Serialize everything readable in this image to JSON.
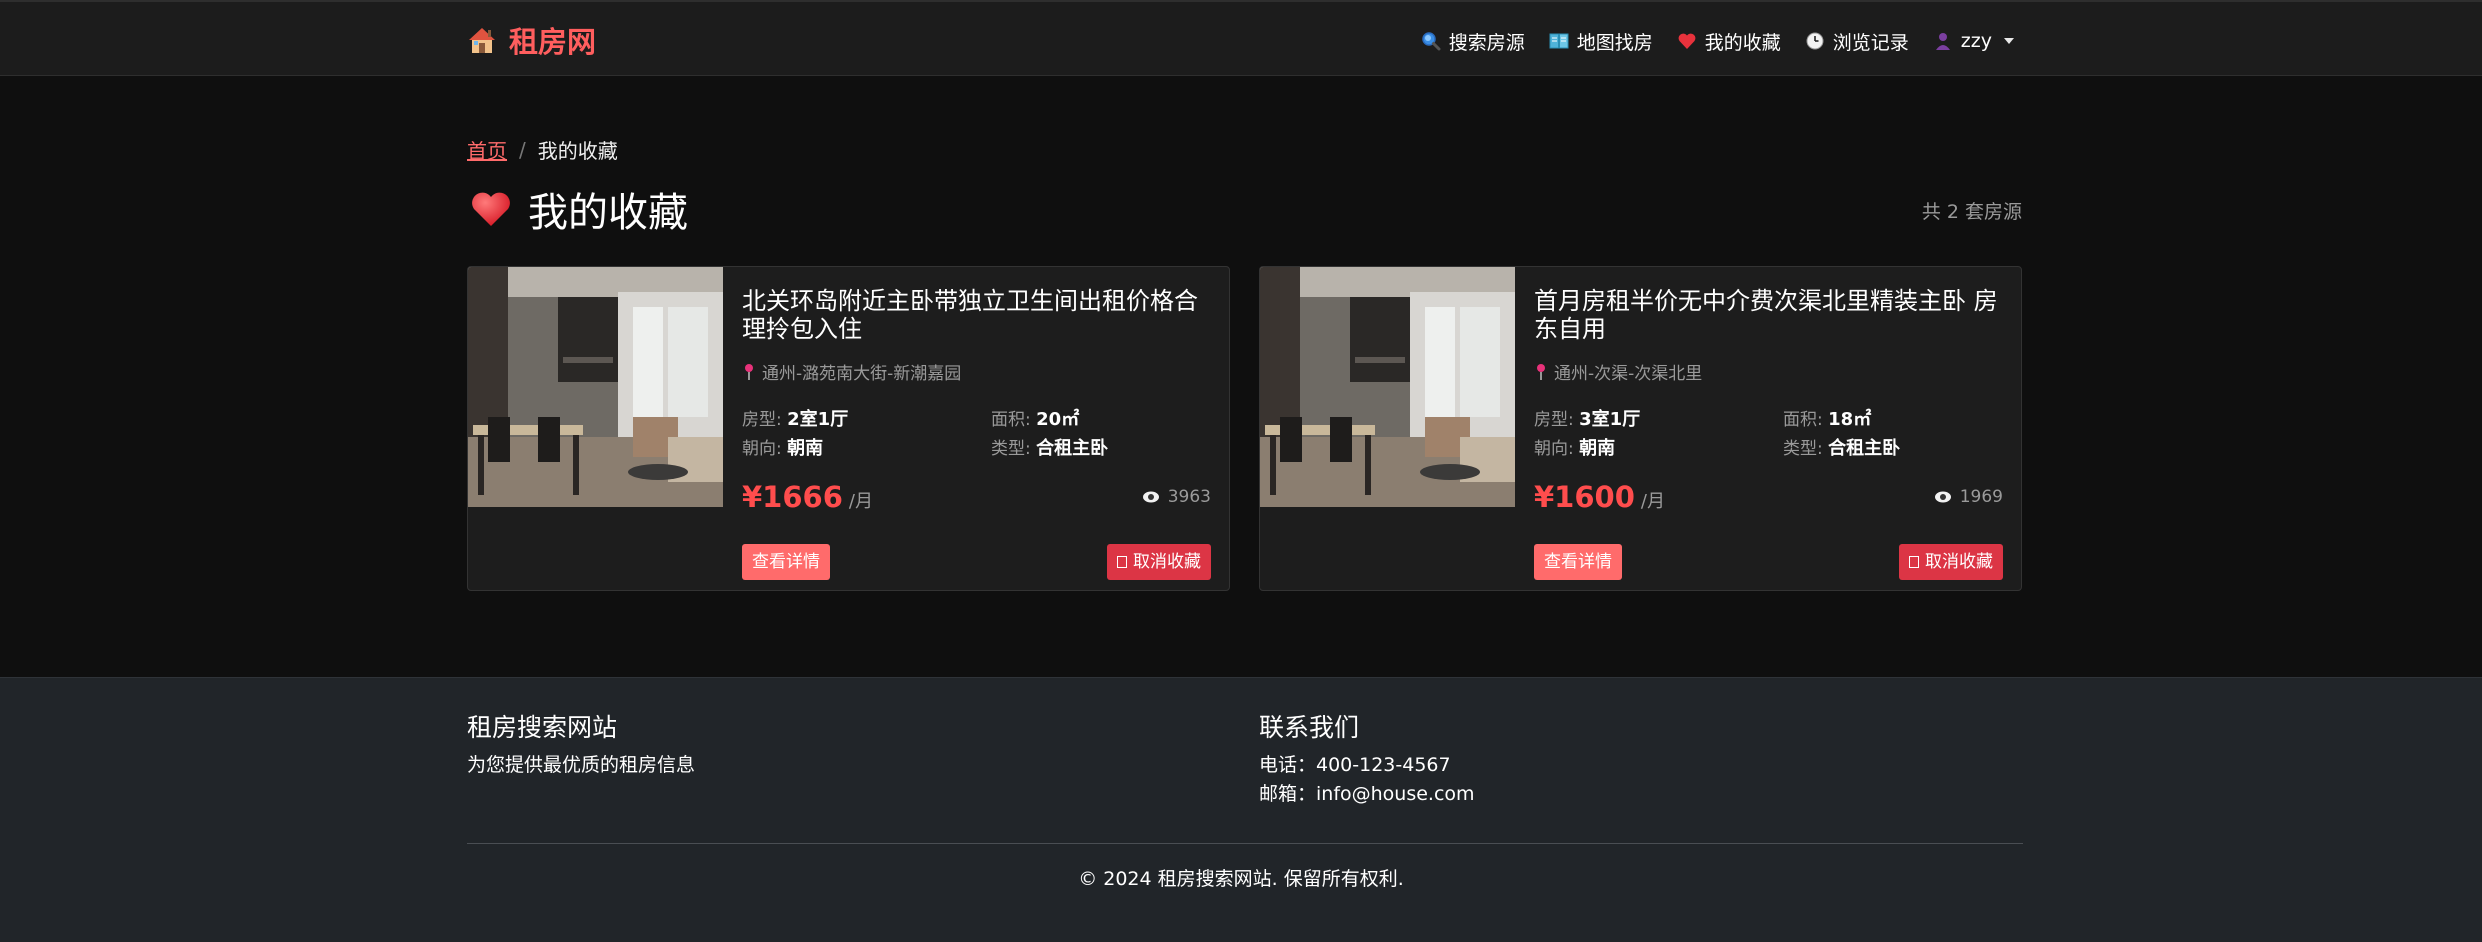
{
  "brand": {
    "name": "租房网",
    "icon": "house-icon",
    "color": "#ff5e5e"
  },
  "nav": [
    {
      "label": "搜索房源",
      "icon": "magnifier-icon"
    },
    {
      "label": "地图找房",
      "icon": "map-book-icon"
    },
    {
      "label": "我的收藏",
      "icon": "heart-icon"
    },
    {
      "label": "浏览记录",
      "icon": "clock-icon"
    },
    {
      "label": "zzy",
      "icon": "user-icon"
    }
  ],
  "breadcrumb": {
    "home": "首页",
    "separator": "/",
    "current": "我的收藏"
  },
  "page": {
    "title": "我的收藏",
    "count_text": "共 2 套房源"
  },
  "cards": [
    {
      "title": "北关环岛附近主卧带独立卫生间出租价格合理拎包入住",
      "location": "通州-潞苑南大街-新潮嘉园",
      "layout_label": "房型:",
      "layout": "2室1厅",
      "area_label": "面积:",
      "area": "20㎡",
      "orientation_label": "朝向:",
      "orientation": "朝南",
      "type_label": "类型:",
      "type": "合租主卧",
      "price": "¥1666",
      "price_unit": "/月",
      "views": "3963",
      "detail_button": "查看详情",
      "unfav_button": "取消收藏"
    },
    {
      "title": "首月房租半价无中介费次渠北里精装主卧 房东自用",
      "location": "通州-次渠-次渠北里",
      "layout_label": "房型:",
      "layout": "3室1厅",
      "area_label": "面积:",
      "area": "18㎡",
      "orientation_label": "朝向:",
      "orientation": "朝南",
      "type_label": "类型:",
      "type": "合租主卧",
      "price": "¥1600",
      "price_unit": "/月",
      "views": "1969",
      "detail_button": "查看详情",
      "unfav_button": "取消收藏"
    }
  ],
  "footer": {
    "left_title": "租房搜索网站",
    "left_text": "为您提供最优质的租房信息",
    "right_title": "联系我们",
    "phone": "电话：400-123-4567",
    "email": "邮箱：info@house.com",
    "copyright": "© 2024 租房搜索网站. 保留所有权利."
  },
  "colors": {
    "accent": "#ff6b6b",
    "price": "#ff4d4d",
    "danger": "#dc3545",
    "navbar_bg": "#1c1c1c",
    "page_bg": "#0f0f0f",
    "footer_bg": "#212529"
  }
}
